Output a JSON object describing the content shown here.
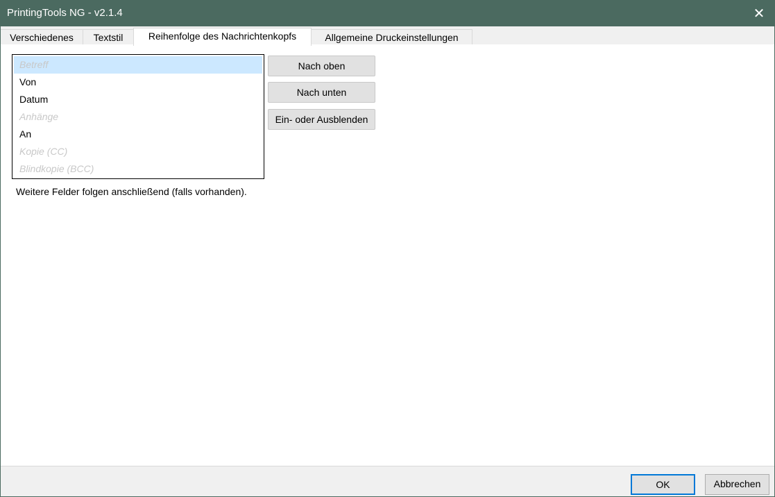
{
  "window": {
    "title": "PrintingTools NG - v2.1.4",
    "close_icon": "close-icon"
  },
  "tabs": [
    {
      "label": "Verschiedenes",
      "active": false
    },
    {
      "label": "Textstil",
      "active": false
    },
    {
      "label": "Reihenfolge des Nachrichtenkopfs",
      "active": true
    },
    {
      "label": "Allgemeine Druckeinstellungen",
      "active": false
    }
  ],
  "header_list": {
    "items": [
      {
        "label": "Betreff",
        "visible": false,
        "selected": true
      },
      {
        "label": "Von",
        "visible": true,
        "selected": false
      },
      {
        "label": "Datum",
        "visible": true,
        "selected": false
      },
      {
        "label": "Anhänge",
        "visible": false,
        "selected": false
      },
      {
        "label": "An",
        "visible": true,
        "selected": false
      },
      {
        "label": "Kopie (CC)",
        "visible": false,
        "selected": false
      },
      {
        "label": "Blindkopie (BCC)",
        "visible": false,
        "selected": false
      }
    ]
  },
  "buttons": {
    "up": "Nach oben",
    "down": "Nach unten",
    "toggle": "Ein- oder Ausblenden"
  },
  "note": "Weitere Felder folgen anschließend (falls vorhanden).",
  "footer": {
    "ok": "OK",
    "cancel": "Abbrechen"
  },
  "colors": {
    "titlebar": "#4b6a60",
    "selection": "#cce8ff",
    "focus": "#0078d7"
  }
}
